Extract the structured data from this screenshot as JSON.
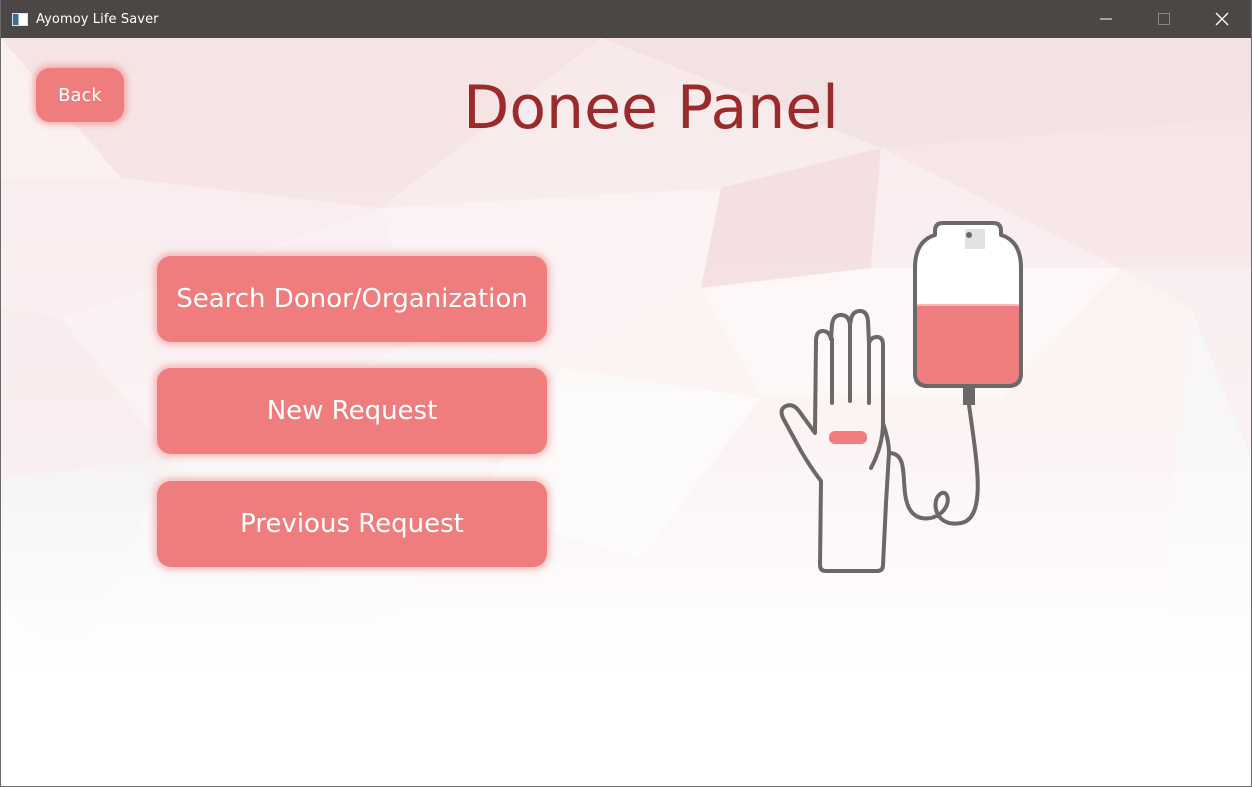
{
  "window": {
    "title": "Ayomoy Life Saver",
    "icons": [
      "app-icon",
      "minimize-icon",
      "maximize-icon",
      "close-icon"
    ]
  },
  "header": {
    "back_label": "Back",
    "title": "Donee Panel"
  },
  "menu": {
    "items": [
      {
        "label": "Search Donor/Organization"
      },
      {
        "label": "New Request"
      },
      {
        "label": "Previous Request"
      }
    ]
  },
  "illustration": {
    "icon": "blood-transfusion-icon"
  },
  "colors": {
    "titlebar": "#4a4745",
    "button": "#f07d7d",
    "title_text": "#9b2a2a",
    "illustration_stroke": "#6b6868",
    "blood": "#f07d7d"
  }
}
